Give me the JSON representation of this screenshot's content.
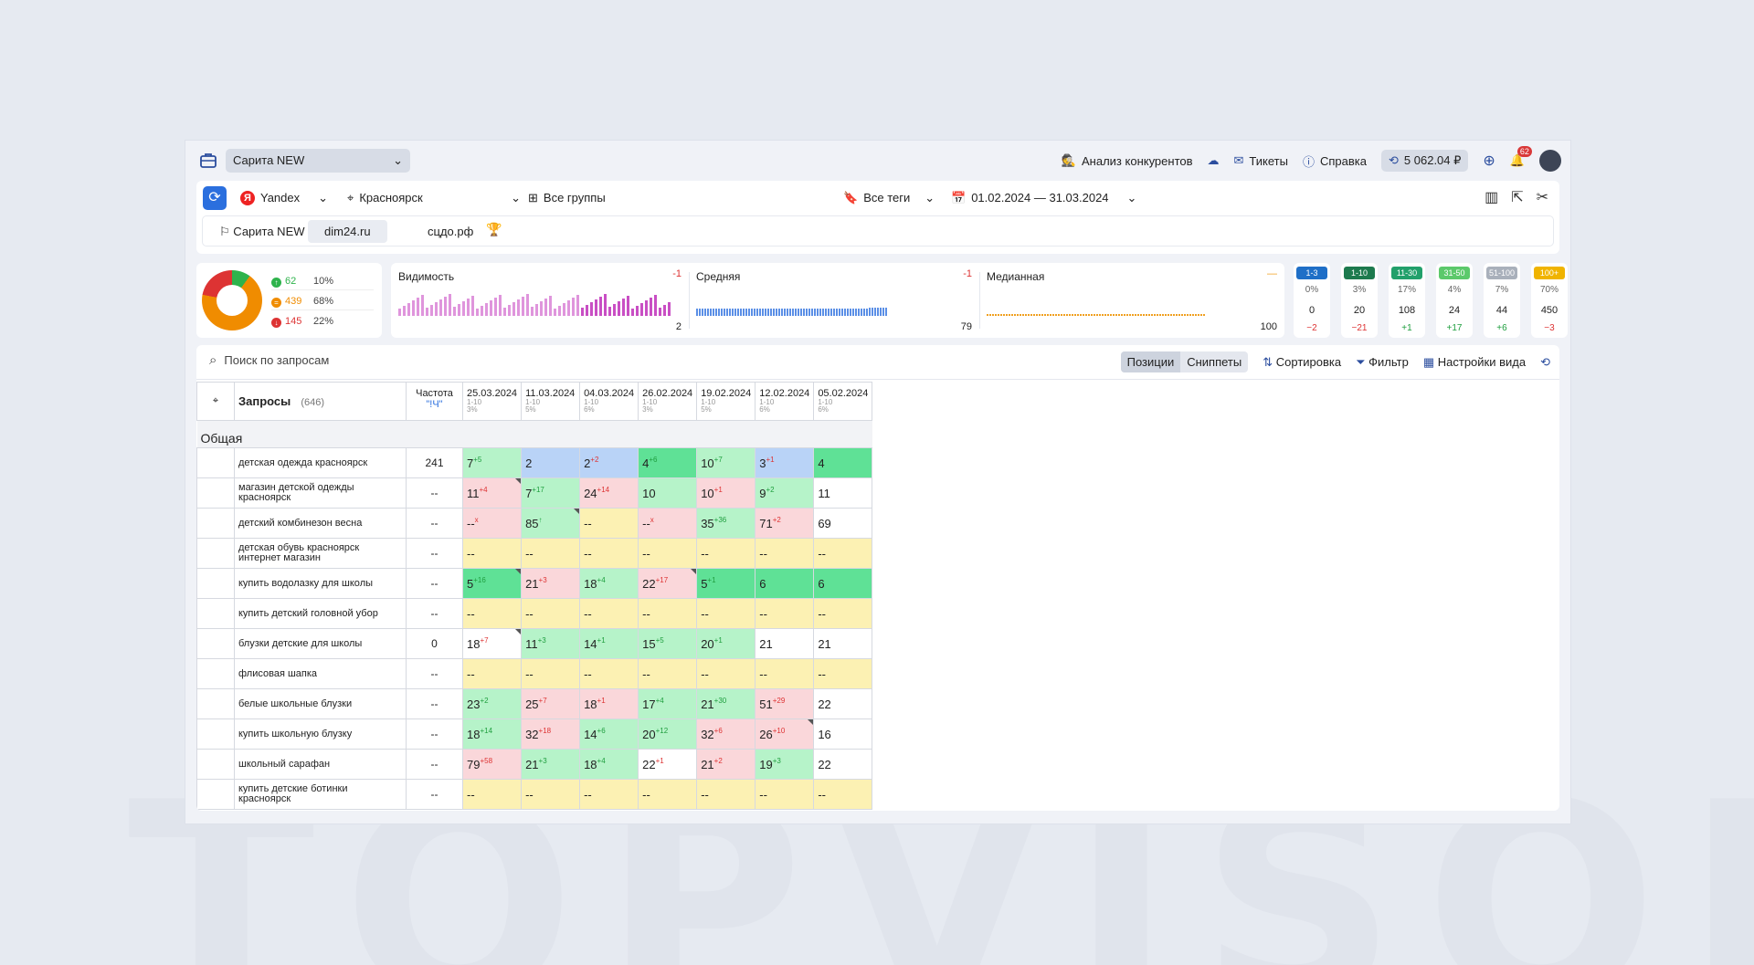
{
  "watermark": "TOPVISOR",
  "topbar": {
    "project": "Сарита NEW",
    "competitors": "Анализ конкурентов",
    "tickets": "Тикеты",
    "help": "Справка",
    "balance": "5 062.04 ₽",
    "notifications": "62"
  },
  "filters": {
    "engine": "Yandex",
    "region": "Красноярск",
    "groups": "Все группы",
    "tags": "Все теги",
    "dates": "01.02.2024 — 31.03.2024"
  },
  "sites": [
    "Сарита NEW",
    "dim24.ru",
    "сцдо.рф"
  ],
  "distribution": [
    {
      "count": "62",
      "pct": "10%",
      "color": "#2eb34c",
      "icon": "arrow-up-icon"
    },
    {
      "count": "439",
      "pct": "68%",
      "color": "#f08c00",
      "icon": "equal-icon"
    },
    {
      "count": "145",
      "pct": "22%",
      "color": "#d33",
      "icon": "arrow-down-icon"
    }
  ],
  "metrics": [
    {
      "name": "Видимость",
      "delta": "-1",
      "value": "2",
      "color": "#c94fc4"
    },
    {
      "name": "Средняя",
      "delta": "-1",
      "value": "79",
      "color": "#5b8fe6"
    },
    {
      "name": "Медианная",
      "delta": "—",
      "value": "100",
      "color": "#f0a020"
    }
  ],
  "ranges": [
    {
      "label": "1-3",
      "pct": "0%",
      "count": "0",
      "delta": "−2",
      "color": "#1f6fc7",
      "up": false
    },
    {
      "label": "1-10",
      "pct": "3%",
      "count": "20",
      "delta": "−21",
      "color": "#1d7a4e",
      "up": false
    },
    {
      "label": "11-30",
      "pct": "17%",
      "count": "108",
      "delta": "+1",
      "color": "#22a06b",
      "up": true
    },
    {
      "label": "31-50",
      "pct": "4%",
      "count": "24",
      "delta": "+17",
      "color": "#5cc96b",
      "up": true
    },
    {
      "label": "51-100",
      "pct": "7%",
      "count": "44",
      "delta": "+6",
      "color": "#a9b0bb",
      "up": true
    },
    {
      "label": "100+",
      "pct": "70%",
      "count": "450",
      "delta": "−3",
      "color": "#f0b400",
      "up": false
    }
  ],
  "toolbar": {
    "search_placeholder": "Поиск по запросам",
    "positions": "Позиции",
    "snippets": "Сниппеты",
    "sort": "Сортировка",
    "filter": "Фильтр",
    "view": "Настройки вида"
  },
  "table": {
    "queries_label": "Запросы",
    "queries_count": "(646)",
    "freq_label": "Частота",
    "freq_sub": "\"!Ч\"",
    "dates": [
      {
        "d": "25.03.2024",
        "r": "1-10",
        "p": "3%"
      },
      {
        "d": "11.03.2024",
        "r": "1-10",
        "p": "5%"
      },
      {
        "d": "04.03.2024",
        "r": "1-10",
        "p": "6%"
      },
      {
        "d": "26.02.2024",
        "r": "1-10",
        "p": "3%"
      },
      {
        "d": "19.02.2024",
        "r": "1-10",
        "p": "5%"
      },
      {
        "d": "12.02.2024",
        "r": "1-10",
        "p": "6%"
      },
      {
        "d": "05.02.2024",
        "r": "1-10",
        "p": "6%"
      }
    ],
    "group": "Общая",
    "rows": [
      {
        "q": "детская одежда красноярск",
        "f": "241",
        "cells": [
          [
            "7",
            "+5",
            "g",
            0
          ],
          [
            "2",
            "",
            "b",
            0
          ],
          [
            "2",
            "+2",
            "b",
            0
          ],
          [
            "4",
            "+6",
            "dg",
            0
          ],
          [
            "10",
            "+7",
            "g",
            0
          ],
          [
            "3",
            "+1",
            "b",
            0
          ],
          [
            "4",
            "",
            "dg",
            0
          ]
        ]
      },
      {
        "q": "магазин детской одежды красноярск",
        "f": "--",
        "cells": [
          [
            "11",
            "+4",
            "r",
            1
          ],
          [
            "7",
            "+17",
            "g",
            0
          ],
          [
            "24",
            "+14",
            "r",
            0
          ],
          [
            "10",
            "",
            "g",
            0
          ],
          [
            "10",
            "+1",
            "r",
            0
          ],
          [
            "9",
            "+2",
            "g",
            0
          ],
          [
            "11",
            "",
            "w",
            0
          ]
        ]
      },
      {
        "q": "детский комбинезон весна",
        "f": "--",
        "cells": [
          [
            "--",
            "x",
            "r",
            0
          ],
          [
            "85",
            "↑",
            "g",
            1
          ],
          [
            "--",
            "",
            "y",
            0
          ],
          [
            "--",
            "x",
            "r",
            0
          ],
          [
            "35",
            "+36",
            "g",
            0
          ],
          [
            "71",
            "+2",
            "r",
            0
          ],
          [
            "69",
            "",
            "w",
            0
          ]
        ]
      },
      {
        "q": "детская обувь красноярск интернет магазин",
        "f": "--",
        "cells": [
          [
            "--",
            "",
            "y",
            0
          ],
          [
            "--",
            "",
            "y",
            0
          ],
          [
            "--",
            "",
            "y",
            0
          ],
          [
            "--",
            "",
            "y",
            0
          ],
          [
            "--",
            "",
            "y",
            0
          ],
          [
            "--",
            "",
            "y",
            0
          ],
          [
            "--",
            "",
            "y",
            0
          ]
        ]
      },
      {
        "q": "купить водолазку для школы",
        "f": "--",
        "cells": [
          [
            "5",
            "+16",
            "dg",
            1
          ],
          [
            "21",
            "+3",
            "r",
            0
          ],
          [
            "18",
            "+4",
            "g",
            0
          ],
          [
            "22",
            "+17",
            "r",
            1
          ],
          [
            "5",
            "+1",
            "dg",
            0
          ],
          [
            "6",
            "",
            "dg",
            0
          ],
          [
            "6",
            "",
            "dg",
            0
          ]
        ]
      },
      {
        "q": "купить детский головной убор",
        "f": "--",
        "cells": [
          [
            "--",
            "",
            "y",
            0
          ],
          [
            "--",
            "",
            "y",
            0
          ],
          [
            "--",
            "",
            "y",
            0
          ],
          [
            "--",
            "",
            "y",
            0
          ],
          [
            "--",
            "",
            "y",
            0
          ],
          [
            "--",
            "",
            "y",
            0
          ],
          [
            "--",
            "",
            "y",
            0
          ]
        ]
      },
      {
        "q": "блузки детские для школы",
        "f": "0",
        "cells": [
          [
            "18",
            "+7",
            "w",
            1
          ],
          [
            "11",
            "+3",
            "g",
            0
          ],
          [
            "14",
            "+1",
            "g",
            0
          ],
          [
            "15",
            "+5",
            "g",
            0
          ],
          [
            "20",
            "+1",
            "g",
            0
          ],
          [
            "21",
            "",
            "w",
            0
          ],
          [
            "21",
            "",
            "w",
            0
          ]
        ]
      },
      {
        "q": "флисовая шапка",
        "f": "--",
        "cells": [
          [
            "--",
            "",
            "y",
            0
          ],
          [
            "--",
            "",
            "y",
            0
          ],
          [
            "--",
            "",
            "y",
            0
          ],
          [
            "--",
            "",
            "y",
            0
          ],
          [
            "--",
            "",
            "y",
            0
          ],
          [
            "--",
            "",
            "y",
            0
          ],
          [
            "--",
            "",
            "y",
            0
          ]
        ]
      },
      {
        "q": "белые школьные блузки",
        "f": "--",
        "cells": [
          [
            "23",
            "+2",
            "g",
            0
          ],
          [
            "25",
            "+7",
            "r",
            0
          ],
          [
            "18",
            "+1",
            "r",
            0
          ],
          [
            "17",
            "+4",
            "g",
            0
          ],
          [
            "21",
            "+30",
            "g",
            0
          ],
          [
            "51",
            "+29",
            "r",
            0
          ],
          [
            "22",
            "",
            "w",
            0
          ]
        ]
      },
      {
        "q": "купить школьную блузку",
        "f": "--",
        "cells": [
          [
            "18",
            "+14",
            "g",
            0
          ],
          [
            "32",
            "+18",
            "r",
            0
          ],
          [
            "14",
            "+6",
            "g",
            0
          ],
          [
            "20",
            "+12",
            "g",
            0
          ],
          [
            "32",
            "+6",
            "r",
            0
          ],
          [
            "26",
            "+10",
            "r",
            1
          ],
          [
            "16",
            "",
            "w",
            0
          ]
        ]
      },
      {
        "q": "школьный сарафан",
        "f": "--",
        "cells": [
          [
            "79",
            "+58",
            "r",
            0
          ],
          [
            "21",
            "+3",
            "g",
            0
          ],
          [
            "18",
            "+4",
            "g",
            0
          ],
          [
            "22",
            "+1",
            "w",
            0
          ],
          [
            "21",
            "+2",
            "r",
            0
          ],
          [
            "19",
            "+3",
            "g",
            0
          ],
          [
            "22",
            "",
            "w",
            0
          ]
        ]
      },
      {
        "q": "купить детские ботинки красноярск",
        "f": "--",
        "cells": [
          [
            "--",
            "",
            "y",
            0
          ],
          [
            "--",
            "",
            "y",
            0
          ],
          [
            "--",
            "",
            "y",
            0
          ],
          [
            "--",
            "",
            "y",
            0
          ],
          [
            "--",
            "",
            "y",
            0
          ],
          [
            "--",
            "",
            "y",
            0
          ],
          [
            "--",
            "",
            "y",
            0
          ]
        ]
      }
    ]
  }
}
